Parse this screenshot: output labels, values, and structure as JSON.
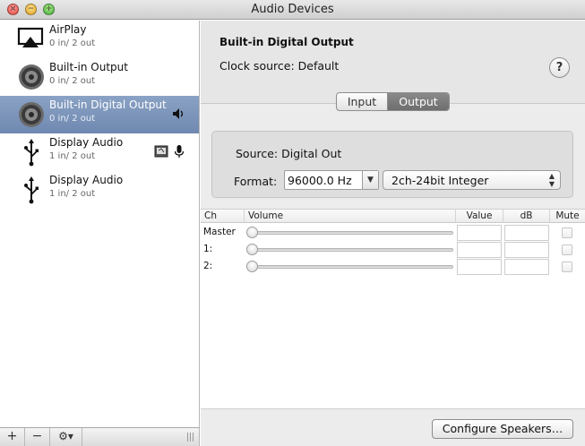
{
  "window": {
    "title": "Audio Devices"
  },
  "devices": [
    {
      "name": "AirPlay",
      "io": "0 in/ 2 out",
      "icon": "airplay-icon"
    },
    {
      "name": "Built-in Output",
      "io": "0 in/ 2 out",
      "icon": "speaker-icon"
    },
    {
      "name": "Built-in Digital Output",
      "io": "0 in/ 2 out",
      "icon": "speaker-icon",
      "selected": true,
      "badge": "volume-icon"
    },
    {
      "name": "Display Audio",
      "io": "1 in/ 2 out",
      "icon": "usb-icon",
      "badges": [
        "finder-icon",
        "microphone-icon"
      ]
    },
    {
      "name": "Display Audio",
      "io": "1 in/ 2 out",
      "icon": "usb-icon"
    }
  ],
  "toolbar": {
    "add": "+",
    "remove": "−",
    "gear": "⚙▾"
  },
  "detail": {
    "title": "Built-in Digital Output",
    "clock_source": "Clock source:  Default",
    "help": "?",
    "tabs": {
      "input": "Input",
      "output": "Output",
      "selected": "Output"
    },
    "source": "Source:  Digital Out",
    "format_label": "Format:",
    "sample_rate": "96000.0 Hz",
    "bit_format": "2ch-24bit Integer"
  },
  "table": {
    "headers": {
      "ch": "Ch",
      "volume": "Volume",
      "value": "Value",
      "db": "dB",
      "mute": "Mute"
    },
    "rows": [
      {
        "label": "Master"
      },
      {
        "label": "1:"
      },
      {
        "label": "2:"
      }
    ]
  },
  "configure_button": "Configure Speakers…",
  "colors": {
    "selection": "#7d96bb",
    "pane": "#ececec"
  }
}
